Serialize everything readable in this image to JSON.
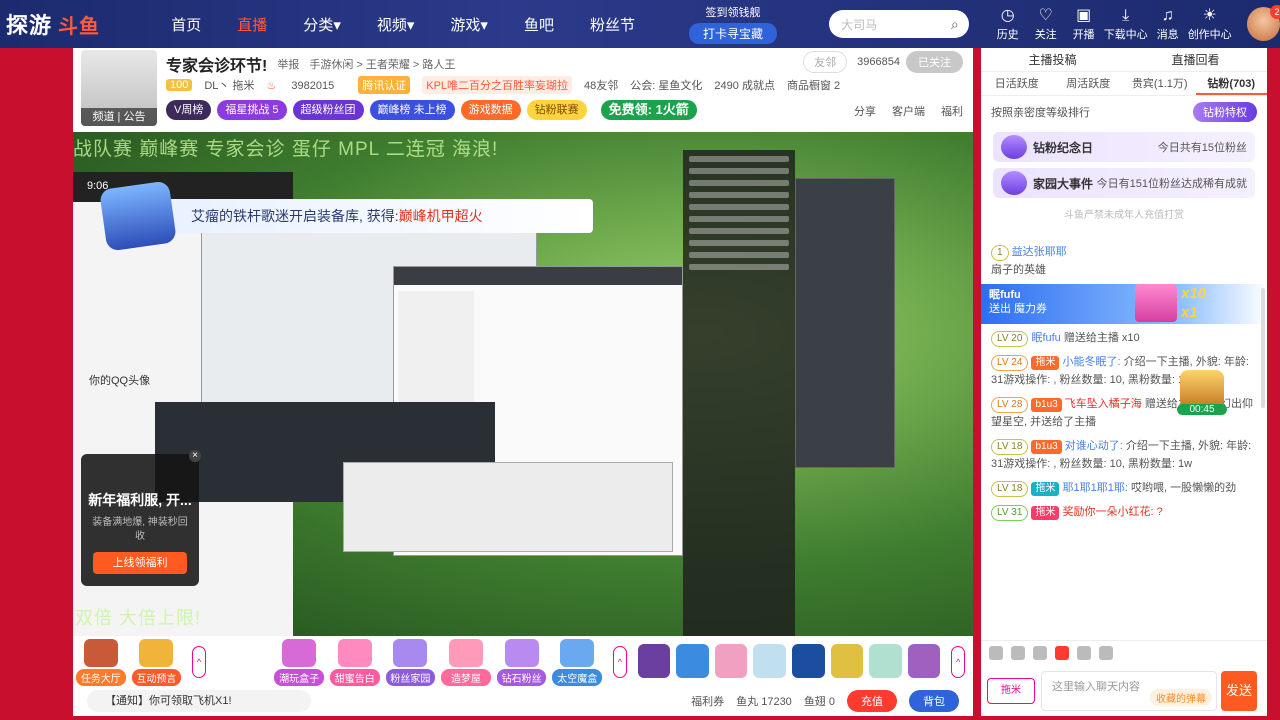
{
  "nav": {
    "logo_left": "探游",
    "logo_right": "斗鱼",
    "items": [
      "首页",
      "直播",
      "分类",
      "视频",
      "游戏",
      "鱼吧",
      "粉丝节"
    ],
    "active": "直播",
    "signin_top": "签到领钱舰",
    "signin_btn": "打卡寻宝藏",
    "search_placeholder": "大司马",
    "icons": [
      {
        "label": "历史",
        "icon": "clock-icon",
        "glyph": "◷"
      },
      {
        "label": "关注",
        "icon": "heart-icon",
        "glyph": "♡"
      },
      {
        "label": "开播",
        "icon": "camera-icon",
        "glyph": "▣"
      },
      {
        "label": "下载中心",
        "icon": "download-icon",
        "glyph": "⤓"
      },
      {
        "label": "消息",
        "icon": "bell-icon",
        "glyph": "♫"
      },
      {
        "label": "创作中心",
        "icon": "bulb-icon",
        "glyph": "☀"
      }
    ],
    "avatar_badge": "2"
  },
  "room": {
    "avatar_tag": "频道 | 公告",
    "title": "专家会诊环节!",
    "report": "举报",
    "breadcrumb": "手游休闲 > 王者荣耀 > 路人王",
    "friend_btn": "友邻",
    "follow_count": "3966854",
    "followed_btn": "已关注",
    "level": "100",
    "owner": "DL丶 拖米",
    "heat": "3982015",
    "cert": "腾讯认证",
    "kpl": "KPL唯二百分之百胜率妄瑚拉",
    "friends": "48友邻",
    "guild": "公会: 星鱼文化",
    "points": "2490 成就点",
    "shop": "商品橱窗 2",
    "pills": [
      "V周榜",
      "福星挑战 5",
      "超级粉丝团",
      "巅峰榜 未上榜",
      "游戏数据",
      "钻粉联赛"
    ],
    "free_btn": "免费领: 1火箭",
    "links": [
      "分享",
      "客户端",
      "福利"
    ]
  },
  "video": {
    "banner_top": "战队赛 巅峰赛 专家会诊 蛋仔 MPL 二连冠 海浪!",
    "banner_bottom": "双倍 大倍上限!",
    "phone_time": "9:06",
    "phone_qq_label": "你的QQ头像",
    "gift_msg_prefix": "艾瘤的铁杆歌迷开启装备库, 获得:",
    "gift_msg_item": "巅峰机甲超火",
    "promo_title": "新年福利服, 开...",
    "promo_sub": "装备满地爆, 神装秒回收",
    "promo_btn": "上线领福利"
  },
  "bottom": {
    "gifts_left": [
      {
        "label": "任务大厅",
        "color": "#ff7a2a"
      },
      {
        "label": "互动预言",
        "color": "#ff5a2a"
      }
    ],
    "gifts_mid": [
      {
        "label": "潮玩盒子",
        "color": "#c84fd8"
      },
      {
        "label": "甜蜜告白",
        "color": "#ff5aa0"
      },
      {
        "label": "粉丝家园",
        "color": "#8c5be0"
      },
      {
        "label": "造梦屋",
        "color": "#ff6a9a"
      },
      {
        "label": "钻石粉丝",
        "color": "#a45be0"
      },
      {
        "label": "太空魔盒",
        "color": "#3b8be0"
      }
    ],
    "notice": "【通知】你可领取飞机X1!",
    "coupon": "福利券",
    "fish_ball": "鱼丸 17230",
    "fish_fin": "鱼翅 0",
    "recharge": "充值",
    "backpack": "背包"
  },
  "side": {
    "top_left": "主播投稿",
    "top_right": "直播回看",
    "tabs": [
      "日活跃度",
      "周活跃度",
      "贵宾(1.1万)",
      "钻粉(703)"
    ],
    "active_tab": "钻粉(703)",
    "rank_desc": "按照亲密度等级排行",
    "vip_btn": "钻粉特权",
    "card1_name": "钻粉纪念日",
    "card1_right": "今日共有15位粉丝",
    "card2_name": "家园大事件",
    "card2_right": "今日有151位粉丝达成稀有成就",
    "warning": "斗鱼严禁未成年人充值打赏",
    "messages": [
      {
        "lv": "1",
        "lvclass": "",
        "fan": "",
        "fanclass": "",
        "name": "益达张耶耶",
        "namecls": "",
        "text": "扇子的英雄"
      },
      {
        "lv": "LV 20",
        "lvclass": "",
        "fan": "",
        "fanclass": "",
        "name": "眠fufu",
        "namecls": "",
        "text": "赠送给主播 x10"
      },
      {
        "lv": "LV 24",
        "lvclass": "lv-orange",
        "fan": "拖米",
        "fanclass": "f1",
        "name": "小能冬眠了:",
        "namecls": "",
        "text": "介绍一下主播, 外貌: 年龄: 31游戏操作: , 粉丝数量: 10, 黑粉数量: 1w"
      },
      {
        "lv": "LV 28",
        "lvclass": "lv-orange",
        "fan": "b1u3",
        "fanclass": "f1",
        "name": "飞车坠入橘子海",
        "namecls": "red",
        "text": "赠送给主播 , 变幻出仰望星空, 并送给了主播"
      },
      {
        "lv": "LV 18",
        "lvclass": "",
        "fan": "b1u3",
        "fanclass": "f1",
        "name": "对谁心动了:",
        "namecls": "",
        "text": "介绍一下主播, 外貌: 年龄: 31游戏操作: , 粉丝数量: 10, 黑粉数量: 1w"
      },
      {
        "lv": "LV 18",
        "lvclass": "",
        "fan": "拖米",
        "fanclass": "f3",
        "name": "耶1耶1耶1耶:",
        "namecls": "",
        "text": "哎哟喂, 一股懒懒的劲"
      },
      {
        "lv": "LV 31",
        "lvclass": "lv-green",
        "fan": "拖米",
        "fanclass": "f2",
        "name": "奖励你一朵小红花:",
        "namecls": "red",
        "text": "?"
      }
    ],
    "gift_strip_name": "眠fufu",
    "gift_strip_sub": "送出 魔力券",
    "gift_strip_mul1": "x10",
    "gift_strip_mul2": "x1",
    "timer": "00:45",
    "input_placeholder": "这里输入聊天内容",
    "input_tip": "收藏的弹幕",
    "fan_label": "拖米",
    "send": "发送"
  }
}
